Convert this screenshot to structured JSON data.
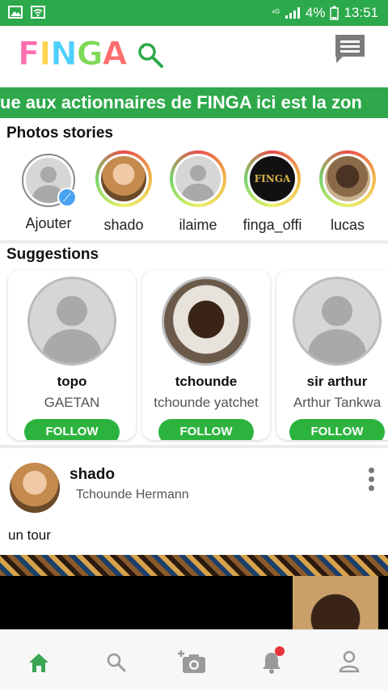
{
  "status_bar": {
    "signal": "⁴ᴳ",
    "battery": "4%",
    "time": "13:51"
  },
  "app": {
    "logo_letters": [
      "F",
      "I",
      "N",
      "G",
      "A"
    ],
    "logo_colors": [
      "#ff6fb0",
      "#ffd34d",
      "#4dd0ff",
      "#7ed957",
      "#ff6f6f"
    ]
  },
  "ticker": {
    "text": "ue aux actionnaires de FINGA ici est la zon"
  },
  "stories": {
    "title": "Photos stories",
    "items": [
      {
        "label": "Ajouter",
        "type": "add"
      },
      {
        "label": "shado",
        "type": "photo"
      },
      {
        "label": "ilaime",
        "type": "generic"
      },
      {
        "label": "finga_offi",
        "type": "logo",
        "logo_text": "FINGA"
      },
      {
        "label": "lucas",
        "type": "photo"
      }
    ]
  },
  "suggestions": {
    "title": "Suggestions",
    "items": [
      {
        "username": "topo",
        "fullname": "GAETAN",
        "button": "FOLLOW"
      },
      {
        "username": "tchounde",
        "fullname": "tchounde yatchet",
        "button": "FOLLOW"
      },
      {
        "username": "sir arthur",
        "fullname": "Arthur Tankwa",
        "button": "FOLLOW"
      }
    ]
  },
  "post": {
    "author": "shado",
    "subtitle": "Tchounde Hermann",
    "caption": "un tour"
  },
  "nav": {
    "items": [
      {
        "icon": "home-icon",
        "active": true
      },
      {
        "icon": "search-icon",
        "active": false
      },
      {
        "icon": "camera-add-icon",
        "active": false
      },
      {
        "icon": "bell-icon",
        "active": false,
        "badge": true
      },
      {
        "icon": "profile-icon",
        "active": false
      }
    ]
  },
  "colors": {
    "brand_green": "#2ca94b",
    "follow_green": "#2cb33e",
    "nav_active": "#3aa655",
    "nav_inactive": "#9a9a9a"
  }
}
